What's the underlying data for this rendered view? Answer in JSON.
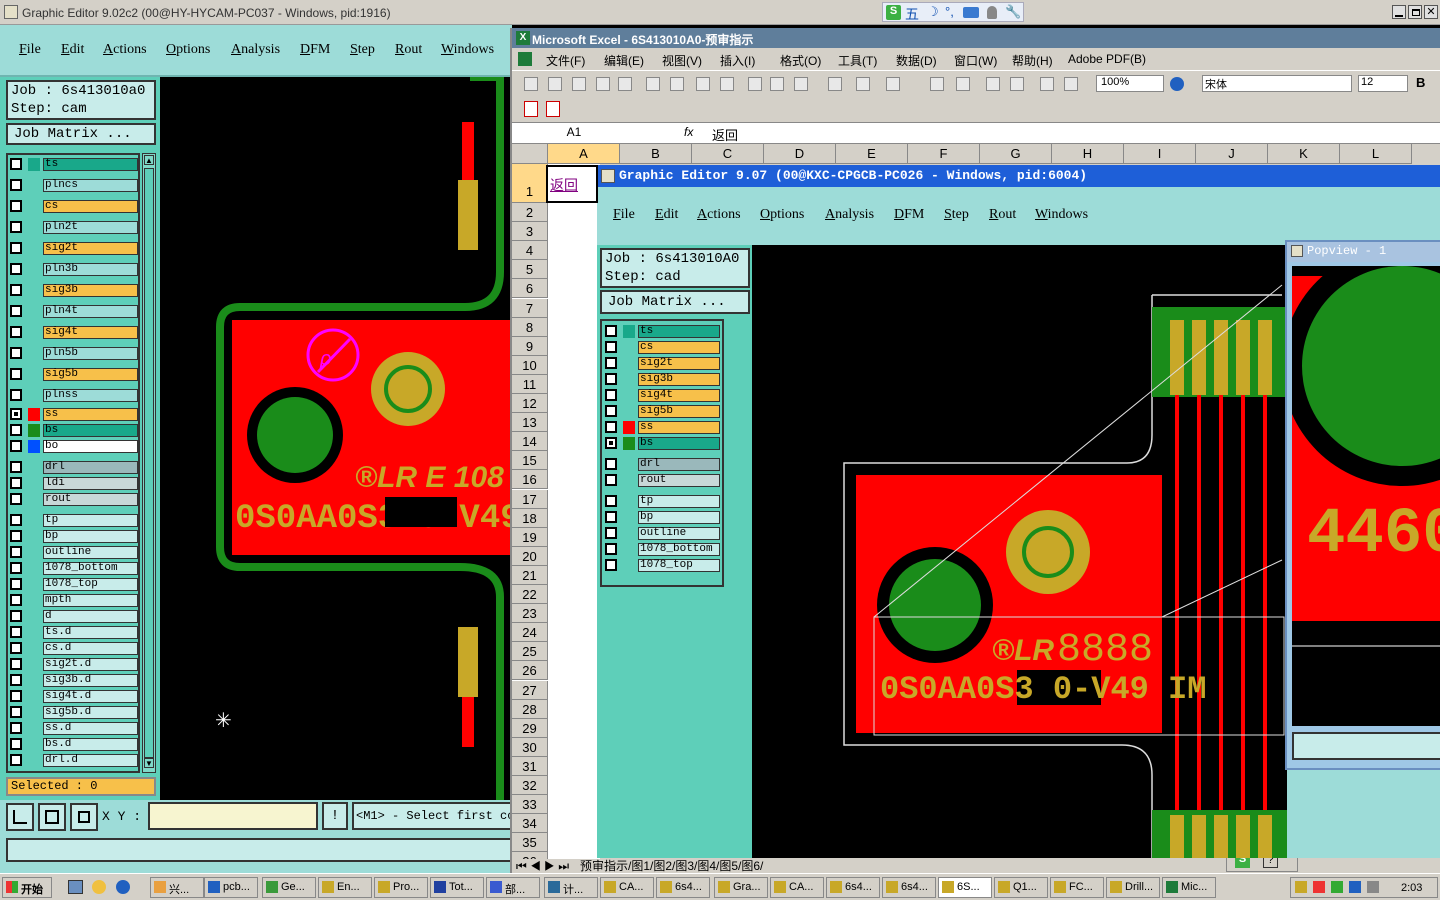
{
  "ge1": {
    "title": "Graphic Editor 9.02c2 (00@HY-HYCAM-PC037 - Windows, pid:1916)",
    "menu": [
      "File",
      "Edit",
      "Actions",
      "Options",
      "Analysis",
      "DFM",
      "Step",
      "Rout",
      "Windows"
    ],
    "job": "Job : 6s413010a0",
    "step": "Step: cam",
    "job_matrix": "Job Matrix ...",
    "layers": [
      {
        "name": "ts",
        "color": "#19a88a"
      },
      {
        "name": "plncs",
        "color": "#9ddcd8"
      },
      {
        "name": "cs",
        "color": "#f7c04a"
      },
      {
        "name": "pln2t",
        "color": "#9ddcd8"
      },
      {
        "name": "sig2t",
        "color": "#f7c04a"
      },
      {
        "name": "pln3b",
        "color": "#9ddcd8"
      },
      {
        "name": "sig3b",
        "color": "#f7c04a"
      },
      {
        "name": "pln4t",
        "color": "#9ddcd8"
      },
      {
        "name": "sig4t",
        "color": "#f7c04a"
      },
      {
        "name": "pln5b",
        "color": "#9ddcd8"
      },
      {
        "name": "sig5b",
        "color": "#f7c04a"
      },
      {
        "name": "plnss",
        "color": "#9ddcd8"
      }
    ],
    "layers_active": [
      {
        "name": "ss",
        "color": "#f7c04a",
        "swatch": "#ff0000"
      },
      {
        "name": "bs",
        "color": "#19a88a",
        "swatch": "#1a8c1a"
      },
      {
        "name": "bo",
        "color": "#ffffff",
        "swatch": "#0050ff"
      }
    ],
    "layers_drill": [
      {
        "name": "drl",
        "color": "#9ab8bb"
      },
      {
        "name": "ldi",
        "color": "#c8d8d8"
      },
      {
        "name": "rout",
        "color": "#c8d8d8"
      }
    ],
    "layers_misc": [
      "tp",
      "bp",
      "outline",
      "1078_bottom",
      "1078_top",
      "mpth",
      "d",
      "ts.d",
      "cs.d",
      "sig2t.d",
      "sig3b.d",
      "sig4t.d",
      "sig5b.d",
      "ss.d",
      "bs.d",
      "drl.d"
    ],
    "selected": "Selected : 0",
    "xy_label": "X Y :",
    "status": "<M1> - Select first co"
  },
  "excel": {
    "title": "Microsoft Excel - 6S413010A0-预审指示",
    "menu": [
      "文件(F)",
      "编辑(E)",
      "视图(V)",
      "插入(I)",
      "格式(O)",
      "工具(T)",
      "数据(D)",
      "窗口(W)",
      "帮助(H)",
      "Adobe PDF(B)"
    ],
    "zoom": "100%",
    "font": "宋体",
    "font_size": "12",
    "cell_ref": "A1",
    "formula": "返回",
    "columns": [
      "A",
      "B",
      "C",
      "D",
      "E",
      "F",
      "G",
      "H",
      "I",
      "J",
      "K",
      "L"
    ],
    "rows": [
      "1",
      "2",
      "3",
      "4",
      "5",
      "6",
      "7",
      "8",
      "9",
      "10",
      "11",
      "12",
      "13",
      "14",
      "15",
      "16",
      "17",
      "18",
      "19",
      "20",
      "21",
      "22",
      "23",
      "24",
      "25",
      "26",
      "27",
      "28",
      "29",
      "30",
      "31",
      "32",
      "33",
      "34",
      "35",
      "36"
    ],
    "a1_value": "返回",
    "sheet_tabs": "预审指示/图1/图2/图3/图4/图5/图6/"
  },
  "ge2": {
    "title": "Graphic Editor 9.07 (00@KXC-CPGCB-PC026 - Windows, pid:6004)",
    "menu": [
      "File",
      "Edit",
      "Actions",
      "Options",
      "Analysis",
      "DFM",
      "Step",
      "Rout",
      "Windows"
    ],
    "job": "Job : 6s413010A0",
    "step": "Step: cad",
    "job_matrix": "Job Matrix ...",
    "layers": [
      {
        "name": "ts",
        "color": "#19a88a",
        "swatch": ""
      },
      {
        "name": "cs",
        "color": "#f7c04a",
        "swatch": ""
      },
      {
        "name": "sig2t",
        "color": "#f7c04a",
        "swatch": ""
      },
      {
        "name": "sig3b",
        "color": "#f7c04a",
        "swatch": ""
      },
      {
        "name": "sig4t",
        "color": "#f7c04a",
        "swatch": ""
      },
      {
        "name": "sig5b",
        "color": "#f7c04a",
        "swatch": ""
      },
      {
        "name": "ss",
        "color": "#f7c04a",
        "swatch": "#ff0000"
      },
      {
        "name": "bs",
        "color": "#19a88a",
        "swatch": "#1a8c1a"
      }
    ],
    "layers_drill": [
      {
        "name": "drl",
        "color": "#9ab8bb"
      },
      {
        "name": "rout",
        "color": "#c8d8d8"
      }
    ],
    "layers_misc": [
      "tp",
      "bp",
      "outline",
      "1078_bottom",
      "1078_top"
    ],
    "popview_title": "Popview - 1"
  },
  "pcb_text": {
    "code1": "0S0AA0S3 0-V49 IM",
    "logo_code": "8888",
    "popview_text": "4460"
  },
  "taskbar": {
    "start": "开始",
    "items": [
      "兴...",
      "pcb...",
      "Ge...",
      "En...",
      "Pro...",
      "Tot...",
      "部...",
      "计...",
      "CA...",
      "6s4...",
      "Gra...",
      "CA...",
      "6s4...",
      "6s4...",
      "6S...",
      "Q1...",
      "FC...",
      "Drill...",
      "Mic..."
    ],
    "clock": "2:03"
  },
  "ime": {
    "label": "五"
  }
}
